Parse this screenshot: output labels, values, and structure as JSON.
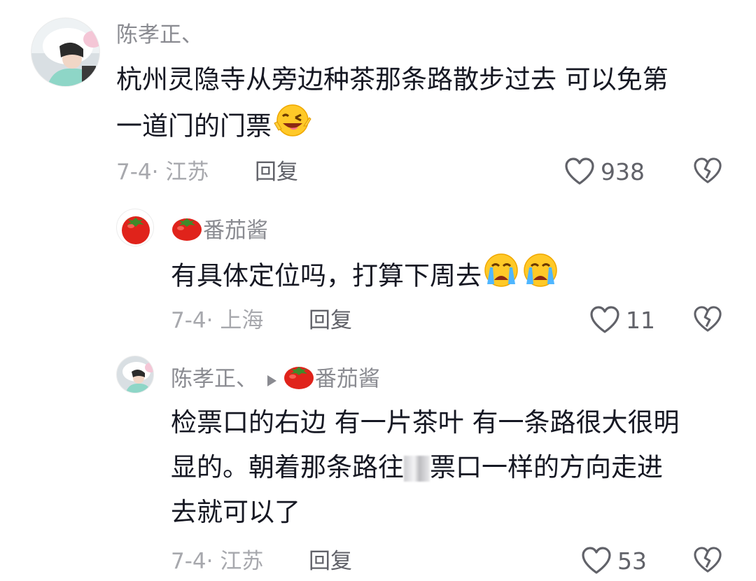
{
  "comments": [
    {
      "author": "陈孝正、",
      "text": "杭州灵隐寺从旁边种茶那条路散步过去 可以免第一道门的门票",
      "text_line1": "杭州灵隐寺从旁边种茶那条路散步过去 可以免第",
      "text_line2": "一道门的门票",
      "emoji": "winking-face-emoji",
      "date": "7-4",
      "location": "江苏",
      "reply_label": "回复",
      "likes": "938"
    }
  ],
  "replies": [
    {
      "author": "番茄酱",
      "text": "有具体定位吗，打算下周去",
      "emojis": [
        "crying-face-emoji",
        "crying-face-emoji"
      ],
      "date": "7-4",
      "location": "上海",
      "reply_label": "回复",
      "likes": "11"
    },
    {
      "author": "陈孝正、",
      "reply_to": "番茄酱",
      "text_line1": "检票口的右边 有一片茶叶 有一条路很大很明",
      "text_line2a": "显的。朝着那条路往",
      "text_line2b": "票口一样的方向走进",
      "text_line3": "去就可以了",
      "date": "7-4",
      "location": "江苏",
      "reply_label": "回复",
      "likes": "53"
    }
  ],
  "colors": {
    "text": "#161823",
    "name": "#8a8b91",
    "meta": "#a7a8ad",
    "action": "#616269"
  }
}
